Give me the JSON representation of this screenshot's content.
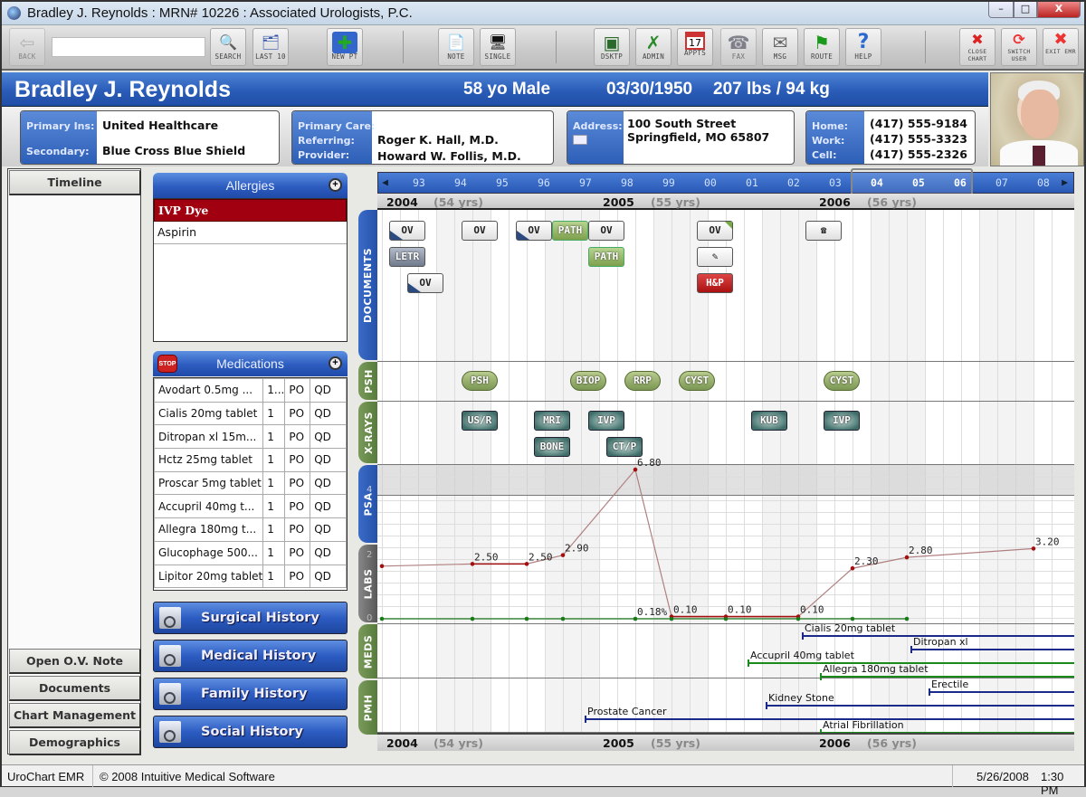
{
  "window": {
    "title": "Bradley J. Reynolds : MRN# 10226 : Associated Urologists, P.C.",
    "controls": {
      "minimize": "–",
      "maximize": "□",
      "close": "X"
    }
  },
  "toolbar": {
    "search_value": "",
    "buttons": [
      {
        "id": "back",
        "label": "BACK",
        "icon": "back-arrow-icon",
        "glyph": "⇦",
        "enabled": false
      },
      {
        "id": "search",
        "label": "SEARCH",
        "icon": "search-icon",
        "glyph": "🔍"
      },
      {
        "id": "last10",
        "label": "LAST 10",
        "icon": "folders-icon",
        "glyph": "🗂"
      },
      {
        "id": "newpt",
        "label": "NEW PT",
        "icon": "new-patient-icon",
        "glyph": "✚"
      },
      {
        "id": "note",
        "label": "NOTE",
        "icon": "note-icon",
        "glyph": "📄"
      },
      {
        "id": "single",
        "label": "SINGLE",
        "icon": "monitor-icon",
        "glyph": "🖥"
      },
      {
        "id": "dsktp",
        "label": "DSKTP",
        "icon": "desktop-icon",
        "glyph": "▣"
      },
      {
        "id": "admin",
        "label": "ADMIN",
        "icon": "tools-icon",
        "glyph": "✗"
      },
      {
        "id": "appts",
        "label": "APPTS",
        "icon": "calendar-icon",
        "glyph": "17"
      },
      {
        "id": "fax",
        "label": "FAX",
        "icon": "fax-icon",
        "glyph": "☎"
      },
      {
        "id": "msg",
        "label": "MSG",
        "icon": "message-icon",
        "glyph": "✉"
      },
      {
        "id": "route",
        "label": "ROUTE",
        "icon": "flag-icon",
        "glyph": "⚑"
      },
      {
        "id": "help",
        "label": "HELP",
        "icon": "help-icon",
        "glyph": "?"
      },
      {
        "id": "closechart",
        "label": "CLOSE CHART",
        "icon": "close-chart-icon",
        "glyph": "✖"
      },
      {
        "id": "switchuser",
        "label": "SWITCH USER",
        "icon": "switch-user-icon",
        "glyph": "⟳"
      },
      {
        "id": "exitemr",
        "label": "EXIT EMR",
        "icon": "exit-icon",
        "glyph": "✖"
      }
    ]
  },
  "patient": {
    "name": "Bradley J. Reynolds",
    "age_sex": "58 yo Male",
    "dob": "03/30/1950",
    "weight": "207 lbs / 94 kg",
    "insurance": {
      "primary_label": "Primary Ins:",
      "primary": "United Healthcare",
      "secondary_label": "Secondary:",
      "secondary": "Blue Cross Blue Shield"
    },
    "providers": {
      "primary_care_label": "Primary Care:",
      "primary_care": "",
      "referring_label": "Referring:",
      "referring": "Roger K. Hall, M.D.",
      "provider_label": "Provider:",
      "provider": "Howard W. Follis, M.D."
    },
    "address": {
      "label": "Address:",
      "line1": "100 South Street",
      "line2": "Springfield, MO  65807"
    },
    "phones": {
      "home_label": "Home:",
      "home": "(417) 555-9184",
      "work_label": "Work:",
      "work": "(417) 555-3323",
      "cell_label": "Cell:",
      "cell": "(417) 555-2326"
    }
  },
  "left_nav": {
    "top": "Timeline",
    "bottom": [
      "Open O.V. Note",
      "Documents",
      "Chart Management",
      "Demographics"
    ]
  },
  "allergies": {
    "title": "Allergies",
    "items": [
      {
        "name": "IVP Dye",
        "severe": true
      },
      {
        "name": "Aspirin",
        "severe": false
      }
    ]
  },
  "medications": {
    "title": "Medications",
    "stop_label": "STOP",
    "rows": [
      [
        "Avodart 0.5mg ...",
        "1...",
        "PO",
        "QD"
      ],
      [
        "Cialis 20mg tablet",
        "1",
        "PO",
        "QD"
      ],
      [
        "Ditropan xl 15m...",
        "1",
        "PO",
        "QD"
      ],
      [
        "Hctz 25mg tablet",
        "1",
        "PO",
        "QD"
      ],
      [
        "Proscar 5mg tablet",
        "1",
        "PO",
        "QD"
      ],
      [
        "Accupril 40mg t...",
        "1",
        "PO",
        "QD"
      ],
      [
        "Allegra 180mg t...",
        "1",
        "PO",
        "QD"
      ],
      [
        "Glucophage 500...",
        "1",
        "PO",
        "QD"
      ],
      [
        "Lipitor 20mg tablet",
        "1",
        "PO",
        "QD"
      ]
    ]
  },
  "history_buttons": [
    "Surgical History",
    "Medical History",
    "Family History",
    "Social History"
  ],
  "timeline": {
    "scale_ticks": [
      "93",
      "94",
      "95",
      "96",
      "97",
      "98",
      "99",
      "00",
      "01",
      "02",
      "03",
      "04",
      "05",
      "06",
      "07",
      "08"
    ],
    "selected_ticks": [
      "04",
      "05",
      "06"
    ],
    "years": [
      {
        "year": "2004",
        "age": "(54 yrs)"
      },
      {
        "year": "2005",
        "age": "(55 yrs)"
      },
      {
        "year": "2006",
        "age": "(56 yrs)"
      }
    ],
    "tabs": [
      "DOCUMENTS",
      "PSH",
      "X-RAYS",
      "PSA",
      "LABS",
      "MEDS",
      "PMH"
    ],
    "axis_labels": {
      "psa_4": "4",
      "labs_2": "2",
      "labs_0": "0"
    },
    "documents": [
      {
        "label": "OV",
        "type": "ov",
        "col": 0.4,
        "row": 0
      },
      {
        "label": "LETR",
        "type": "letter",
        "col": 0.4,
        "row": 1
      },
      {
        "label": "OV",
        "type": "ov",
        "col": 1.4,
        "row": 2
      },
      {
        "label": "OV",
        "type": "plain",
        "col": 4.4,
        "row": 0
      },
      {
        "label": "OV",
        "type": "ov",
        "col": 7.4,
        "row": 0
      },
      {
        "label": "PATH",
        "type": "path",
        "col": 9.4,
        "row": 0
      },
      {
        "label": "PATH",
        "type": "path",
        "col": 11.4,
        "row": 1
      },
      {
        "label": "OV",
        "type": "plain",
        "col": 11.4,
        "row": 0
      },
      {
        "label": "OV",
        "type": "ov-green",
        "col": 17.4,
        "row": 0
      },
      {
        "label": "note-edit-icon",
        "type": "note",
        "col": 17.4,
        "row": 1
      },
      {
        "label": "H&P",
        "type": "hp",
        "col": 17.4,
        "row": 2
      },
      {
        "label": "☎",
        "type": "phone",
        "col": 23.4,
        "row": 0
      }
    ],
    "psh": [
      {
        "label": "PSH",
        "col": 4.4
      },
      {
        "label": "BIOP",
        "col": 10.4
      },
      {
        "label": "RRP",
        "col": 13.4
      },
      {
        "label": "CYST",
        "col": 16.4
      },
      {
        "label": "CYST",
        "col": 24.4
      }
    ],
    "xrays": [
      {
        "label": "US/R",
        "col": 4.4,
        "row": 0
      },
      {
        "label": "MRI",
        "col": 8.4,
        "row": 0
      },
      {
        "label": "BONE",
        "col": 8.4,
        "row": 1
      },
      {
        "label": "IVP",
        "col": 11.4,
        "row": 0
      },
      {
        "label": "CT/P",
        "col": 12.4,
        "row": 1
      },
      {
        "label": "KUB",
        "col": 20.4,
        "row": 0
      },
      {
        "label": "IVP",
        "col": 24.4,
        "row": 0
      }
    ],
    "meds_bars": [
      {
        "label": "Cialis 20mg tablet",
        "start_col": 23.2,
        "color": "#1a2a8a"
      },
      {
        "label": "Ditropan xl",
        "start_col": 29.2,
        "color": "#1a2a8a"
      },
      {
        "label": "Accupril 40mg tablet",
        "start_col": 20.2,
        "color": "#1a8a1a"
      },
      {
        "label": "Allegra 180mg tablet",
        "start_col": 24.2,
        "color": "#1a8a1a"
      }
    ],
    "pmh_bars": [
      {
        "label": "Erectile",
        "start_col": 30.2,
        "color": "#1a2a8a"
      },
      {
        "label": "Kidney Stone",
        "start_col": 21.2,
        "color": "#1a2a8a"
      },
      {
        "label": "Prostate Cancer",
        "start_col": 11.2,
        "color": "#1a2a8a"
      },
      {
        "label": "Atrial Fibrillation",
        "start_col": 24.2,
        "color": "#1a8a1a"
      }
    ]
  },
  "chart_data": {
    "type": "line",
    "title": "PSA",
    "ylabel": "PSA",
    "ylim": [
      0,
      8
    ],
    "ticks": [
      0,
      2,
      4
    ],
    "series": [
      {
        "name": "PSA",
        "color": "#a01010",
        "points": [
          {
            "col": 0,
            "value": 2.4,
            "label": ""
          },
          {
            "col": 5,
            "value": 2.5,
            "label": "2.50"
          },
          {
            "col": 8,
            "value": 2.5,
            "label": "2.50"
          },
          {
            "col": 10,
            "value": 2.9,
            "label": "2.90"
          },
          {
            "col": 14,
            "value": 6.8,
            "label": "6.80"
          },
          {
            "col": 16,
            "value": 0.1,
            "label": "0.10"
          },
          {
            "col": 19,
            "value": 0.1,
            "label": "0.10"
          },
          {
            "col": 23,
            "value": 0.1,
            "label": "0.10"
          },
          {
            "col": 26,
            "value": 2.3,
            "label": "2.30"
          },
          {
            "col": 29,
            "value": 2.8,
            "label": "2.80"
          },
          {
            "col": 36,
            "value": 3.2,
            "label": "3.20"
          }
        ]
      },
      {
        "name": "Labs",
        "color": "#1a7a1a",
        "points": [
          {
            "col": 0,
            "value": 0,
            "label": ""
          },
          {
            "col": 5,
            "value": 0,
            "label": ""
          },
          {
            "col": 8,
            "value": 0,
            "label": ""
          },
          {
            "col": 10,
            "value": 0,
            "label": ""
          },
          {
            "col": 14,
            "value": 0,
            "label": "0.18%"
          },
          {
            "col": 16,
            "value": 0,
            "label": ""
          },
          {
            "col": 19,
            "value": 0,
            "label": ""
          },
          {
            "col": 23,
            "value": 0,
            "label": ""
          },
          {
            "col": 26,
            "value": 0,
            "label": ""
          },
          {
            "col": 29,
            "value": 0,
            "label": ""
          }
        ]
      }
    ]
  },
  "status": {
    "app": "UroChart EMR",
    "copyright": "© 2008 Intuitive Medical Software",
    "date": "5/26/2008",
    "time": "1:30 PM"
  }
}
